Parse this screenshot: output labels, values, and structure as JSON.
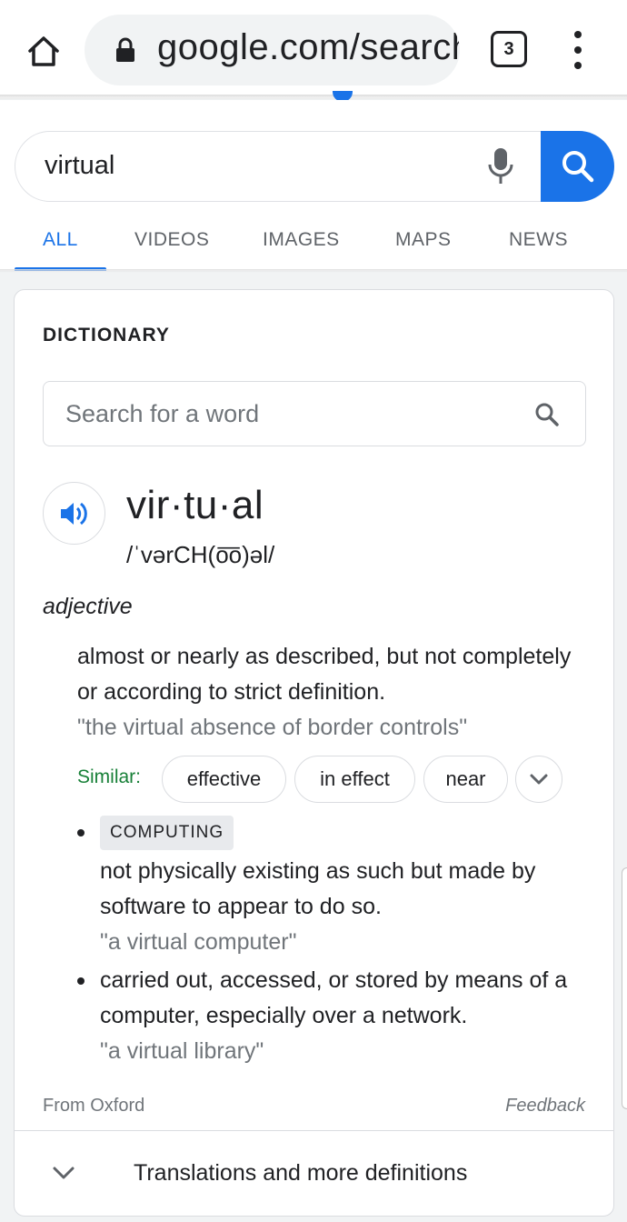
{
  "browser": {
    "url": "google.com/search",
    "tab_count": "3"
  },
  "search": {
    "query": "virtual",
    "tabs": [
      {
        "label": "ALL",
        "active": true
      },
      {
        "label": "VIDEOS",
        "active": false
      },
      {
        "label": "IMAGES",
        "active": false
      },
      {
        "label": "MAPS",
        "active": false
      },
      {
        "label": "NEWS",
        "active": false
      }
    ]
  },
  "dictionary": {
    "title": "DICTIONARY",
    "search_placeholder": "Search for a word",
    "headword": "vir·tu·al",
    "pronunciation": "/ˈvərCH(o͞o)əl/",
    "part_of_speech": "adjective",
    "definitions": [
      {
        "text": "almost or nearly as described, but not completely or according to strict definition.",
        "example": "\"the virtual absence of border controls\""
      }
    ],
    "similar_label": "Similar:",
    "similar": [
      "effective",
      "in effect",
      "near"
    ],
    "senses": [
      {
        "domain": "COMPUTING",
        "text": "not physically existing as such but made by software to appear to do so.",
        "example": "\"a virtual computer\""
      },
      {
        "text": "carried out, accessed, or stored by means of a computer, especially over a network.",
        "example": "\"a virtual library\""
      }
    ],
    "source": "From Oxford",
    "feedback": "Feedback",
    "more_link": "Translations and more definitions"
  },
  "colors": {
    "accent": "#1a73e8",
    "similar_label": "#188038",
    "muted_text": "#70757a"
  },
  "icons": [
    "home-icon",
    "lock-icon",
    "tabs-icon",
    "more-vert-icon",
    "mic-icon",
    "search-icon",
    "speaker-icon",
    "chevron-down-icon"
  ]
}
